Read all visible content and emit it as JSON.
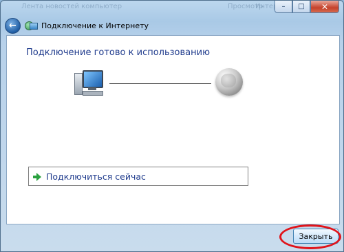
{
  "window": {
    "title": "Подключение к Интернету",
    "background_hint_left": "Лента новостей компьютер",
    "background_hint_right_1": "Просмотр",
    "background_hint_right_2": "Интернет"
  },
  "titlebar_controls": {
    "minimize_symbol": "–",
    "maximize_symbol": "□",
    "close_symbol": "✕"
  },
  "nav": {
    "back_symbol": "←"
  },
  "content": {
    "heading": "Подключение готово к использованию",
    "action_label": "Подключиться сейчас"
  },
  "footer": {
    "close_label": "Закрыть"
  },
  "icons": [
    "back-arrow-icon",
    "network-connection-icon",
    "computer-icon",
    "globe-icon",
    "green-arrow-icon"
  ],
  "colors": {
    "heading": "#1e3a8c",
    "highlight": "#e0141b"
  }
}
